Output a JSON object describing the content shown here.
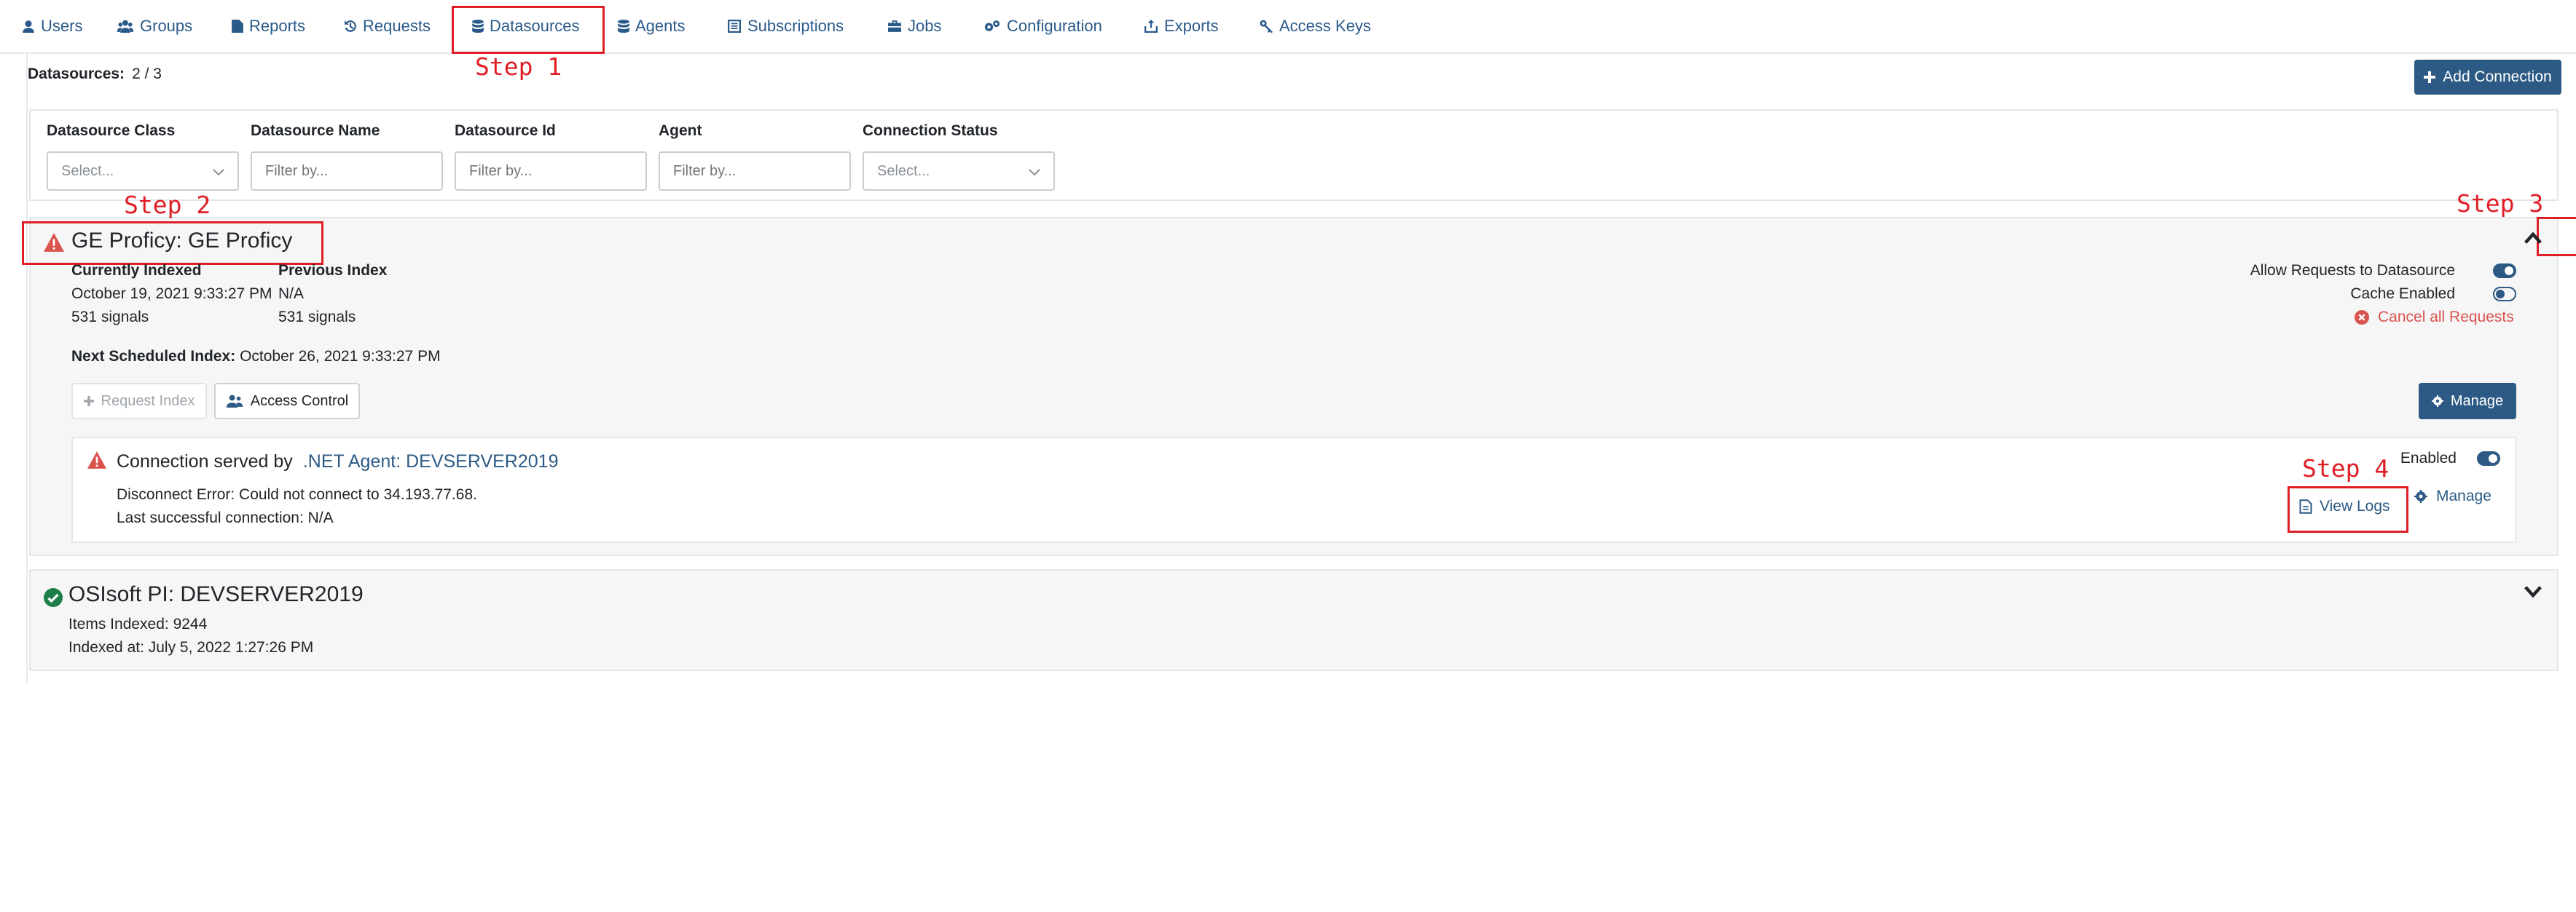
{
  "nav": {
    "items": [
      {
        "label": "Users",
        "icon": "user-icon"
      },
      {
        "label": "Groups",
        "icon": "users-icon"
      },
      {
        "label": "Reports",
        "icon": "file-icon"
      },
      {
        "label": "Requests",
        "icon": "history-icon"
      },
      {
        "label": "Datasources",
        "icon": "database-icon"
      },
      {
        "label": "Agents",
        "icon": "database-icon"
      },
      {
        "label": "Subscriptions",
        "icon": "list-icon"
      },
      {
        "label": "Jobs",
        "icon": "briefcase-icon"
      },
      {
        "label": "Configuration",
        "icon": "cogs-icon"
      },
      {
        "label": "Exports",
        "icon": "export-icon"
      },
      {
        "label": "Access Keys",
        "icon": "key-icon"
      }
    ]
  },
  "summary": {
    "label": "Datasources:",
    "count": "2 / 3"
  },
  "add_connection": {
    "label": "Add Connection"
  },
  "filters": {
    "datasource_class": {
      "label": "Datasource Class",
      "placeholder": "Select..."
    },
    "datasource_name": {
      "label": "Datasource Name",
      "placeholder": "Filter by..."
    },
    "datasource_id": {
      "label": "Datasource Id",
      "placeholder": "Filter by..."
    },
    "agent": {
      "label": "Agent",
      "placeholder": "Filter by..."
    },
    "connection_status": {
      "label": "Connection Status",
      "placeholder": "Select..."
    }
  },
  "datasource1": {
    "title": "GE Proficy: GE Proficy",
    "status_color": "#d9534f",
    "currently_indexed": {
      "heading": "Currently Indexed",
      "date": "October 19, 2021 9:33:27 PM",
      "signals": "531 signals"
    },
    "previous_index": {
      "heading": "Previous Index",
      "date": "N/A",
      "signals": "531 signals"
    },
    "next_scheduled_label": "Next Scheduled Index:",
    "next_scheduled_value": "October 26, 2021 9:33:27 PM",
    "allow_requests_label": "Allow Requests to Datasource",
    "allow_requests_on": true,
    "cache_enabled_label": "Cache Enabled",
    "cache_enabled_on": false,
    "cancel_all_label": "Cancel all Requests",
    "request_index_label": "Request Index",
    "access_control_label": "Access Control",
    "manage_label": "Manage",
    "connection": {
      "served_by_label": "Connection served by",
      "agent_link": ".NET Agent: DEVSERVER2019",
      "error": "Disconnect Error: Could not connect to 34.193.77.68.",
      "last_success": "Last successful connection: N/A",
      "enabled_label": "Enabled",
      "enabled_on": true,
      "view_logs_label": "View Logs",
      "manage_label": "Manage"
    }
  },
  "datasource2": {
    "title": "OSIsoft PI: DEVSERVER2019",
    "status_color": "#1e7e4a",
    "items_indexed": "Items Indexed: 9244",
    "indexed_at": "Indexed at: July 5, 2022 1:27:26 PM"
  },
  "annotations": {
    "step1": "Step 1",
    "step2": "Step 2",
    "step3": "Step 3",
    "step4": "Step 4",
    "color": "#e01e26"
  }
}
